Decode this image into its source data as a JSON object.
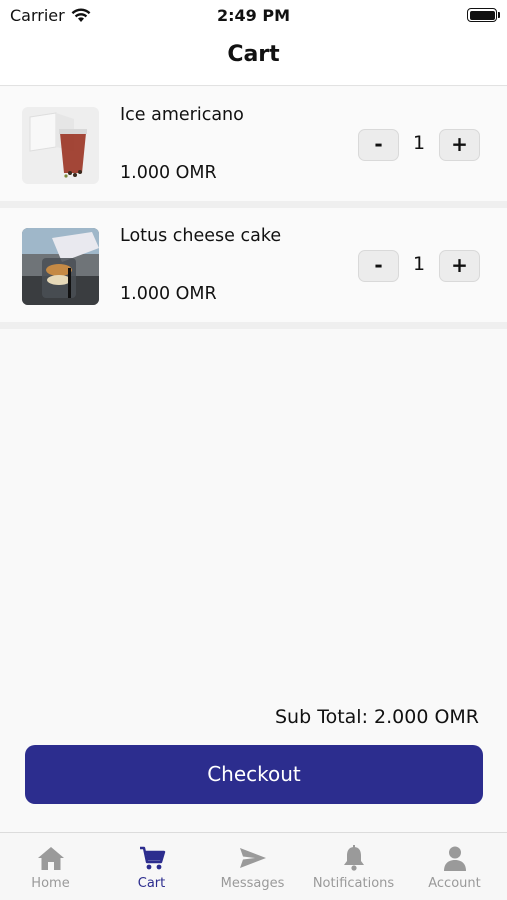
{
  "status_bar": {
    "carrier": "Carrier",
    "time": "2:49 PM"
  },
  "nav": {
    "title": "Cart"
  },
  "cart": {
    "items": [
      {
        "name": "Ice americano",
        "price": "1.000 OMR",
        "quantity": "1"
      },
      {
        "name": "Lotus cheese cake",
        "price": "1.000 OMR",
        "quantity": "1"
      }
    ],
    "stepper": {
      "minus": "-",
      "plus": "+"
    }
  },
  "summary": {
    "subtotal": "Sub Total: 2.000 OMR"
  },
  "checkout": {
    "label": "Checkout"
  },
  "tabs": [
    {
      "label": "Home",
      "icon": "home-icon",
      "active": false
    },
    {
      "label": "Cart",
      "icon": "cart-icon",
      "active": true
    },
    {
      "label": "Messages",
      "icon": "send-icon",
      "active": false
    },
    {
      "label": "Notifications",
      "icon": "bell-icon",
      "active": false
    },
    {
      "label": "Account",
      "icon": "person-icon",
      "active": false
    }
  ],
  "colors": {
    "accent": "#2c2d8e",
    "inactive_tab": "#9a9a9a",
    "background": "#f9f9f9"
  }
}
